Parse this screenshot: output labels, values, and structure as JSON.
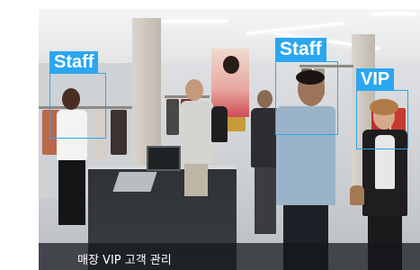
{
  "caption": {
    "text": "매장 VIP 고객 관리"
  },
  "detections": [
    {
      "label": "Staff"
    },
    {
      "label": "Staff"
    },
    {
      "label": "VIP"
    }
  ],
  "colors": {
    "overlay_accent": "#2aa7f0",
    "caption_background": "#14161a"
  }
}
